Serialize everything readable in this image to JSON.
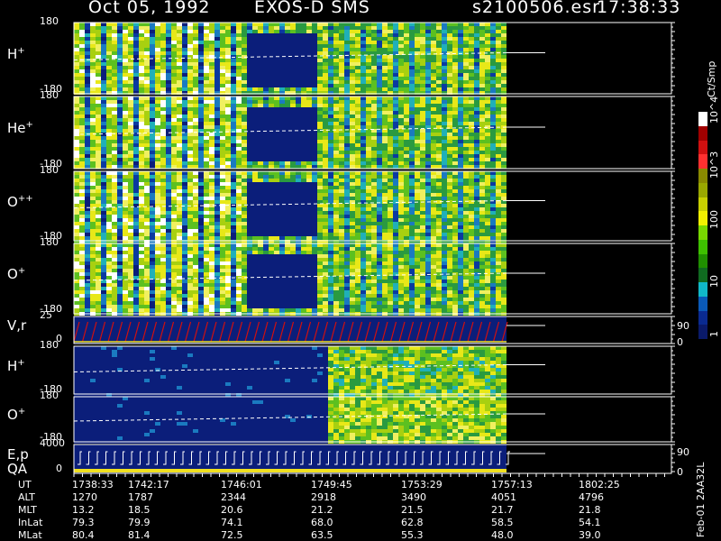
{
  "header": {
    "date": "Oct 05, 1992",
    "mission": "EXOS-D SMS",
    "file": "s2100506.esr",
    "time": "17:38:33"
  },
  "colors": {
    "low": "#0b1e7a",
    "mid": "#2fb0a0",
    "high": "#f0e020",
    "max": "#ffffff",
    "red": "#d01010",
    "dashed": "#ffffff"
  },
  "colorbar": {
    "unit": "Ct/Smp",
    "labels": [
      "1",
      "10",
      "100",
      "10^3",
      "10^4"
    ],
    "swatches": [
      "#ffffff",
      "#a00000",
      "#d01010",
      "#ff3030",
      "#8a8a00",
      "#9aa800",
      "#c8d000",
      "#f0f000",
      "#78d800",
      "#3ec000",
      "#209000",
      "#106a20",
      "#10b8c8",
      "#0a5ab8",
      "#0a2a90",
      "#0a1a6a"
    ]
  },
  "panels": [
    {
      "label": "H",
      "sup": "+",
      "ymax": "180",
      "ymin": "-180"
    },
    {
      "label": "He",
      "sup": "+",
      "ymax": "180",
      "ymin": "-180"
    },
    {
      "label": "O",
      "sup": "++",
      "ymax": "180",
      "ymin": "-180"
    },
    {
      "label": "O",
      "sup": "+",
      "ymax": "180",
      "ymin": "-180"
    },
    {
      "label": "V,r",
      "sup": "",
      "ymax": "25",
      "ymin": "0",
      "right_top": "90",
      "right_bottom": "0"
    },
    {
      "label": "H",
      "sup": "+",
      "ymax": "180",
      "ymin": "-180"
    },
    {
      "label": "O",
      "sup": "+",
      "ymax": "180",
      "ymin": "-180"
    },
    {
      "label": "E,p",
      "label2": "QA",
      "sup": "",
      "ymax": "4000",
      "ymin": "0",
      "right_top": "90",
      "right_bottom": "0"
    }
  ],
  "footer": {
    "side_text": "Feb-01  2AA32L",
    "rows": [
      {
        "label": "UT",
        "values": [
          "1738:33",
          "1742:17",
          "1746:01",
          "1749:45",
          "1753:29",
          "1757:13",
          "1802:25"
        ]
      },
      {
        "label": "ALT",
        "values": [
          "1270",
          "1787",
          "2344",
          "2918",
          "3490",
          "4051",
          "4796"
        ]
      },
      {
        "label": "MLT",
        "values": [
          "13.2",
          "18.5",
          "20.6",
          "21.2",
          "21.5",
          "21.7",
          "21.8"
        ]
      },
      {
        "label": "InLat",
        "values": [
          "79.3",
          "79.9",
          "74.1",
          "68.0",
          "62.8",
          "58.5",
          "54.1"
        ]
      },
      {
        "label": "MLat",
        "values": [
          "80.4",
          "81.4",
          "72.5",
          "63.5",
          "55.3",
          "48.0",
          "39.0"
        ]
      }
    ]
  },
  "chart_data": {
    "type": "heatmap",
    "title": "Oct 05, 1992   EXOS-D SMS",
    "x": [
      "1738:33",
      "1742:17",
      "1746:01",
      "1749:45",
      "1753:29",
      "1757:13",
      "1802:25"
    ],
    "ylim": [
      -180,
      180
    ],
    "colorscale_range": [
      1,
      10000
    ],
    "colorscale_unit": "Ct/Smp",
    "log_scale": true,
    "series": [
      {
        "name": "H+",
        "ylim": [
          -180,
          180
        ]
      },
      {
        "name": "He+",
        "ylim": [
          -180,
          180
        ]
      },
      {
        "name": "O++",
        "ylim": [
          -180,
          180
        ]
      },
      {
        "name": "O+",
        "ylim": [
          -180,
          180
        ]
      },
      {
        "name": "V,r",
        "ylim": [
          0,
          25
        ]
      },
      {
        "name": "H+",
        "ylim": [
          -180,
          180
        ]
      },
      {
        "name": "O+",
        "ylim": [
          -180,
          180
        ]
      },
      {
        "name": "E,p",
        "ylim": [
          0,
          4000
        ]
      }
    ]
  }
}
